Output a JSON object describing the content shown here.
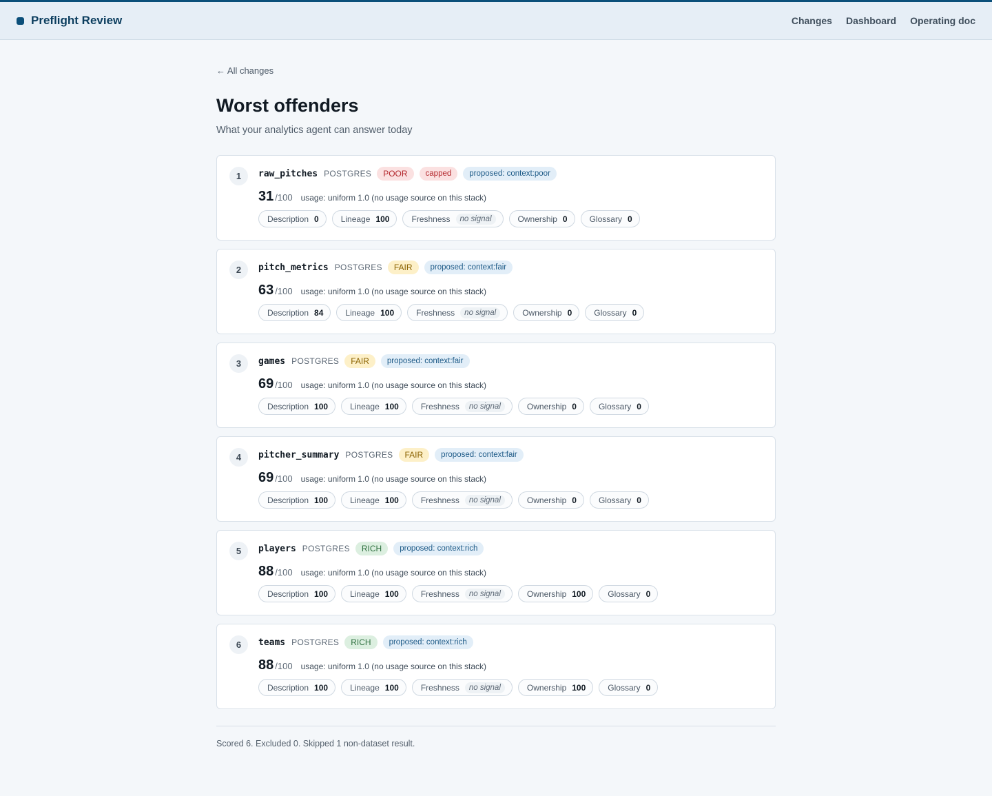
{
  "app": {
    "brand": "Preflight Review"
  },
  "nav": [
    "Changes",
    "Dashboard",
    "Operating doc"
  ],
  "back_link": "← All changes",
  "title": "Worst offenders",
  "subtitle": "What your analytics agent can answer today",
  "out_of": "/100",
  "usage_text": "usage: uniform 1.0 (no usage source on this stack)",
  "metric_labels": [
    "Description",
    "Lineage",
    "Freshness",
    "Ownership",
    "Glossary"
  ],
  "no_signal": "no signal",
  "items": [
    {
      "rank": "1",
      "name": "raw_pitches",
      "platform": "POSTGRES",
      "tier": "POOR",
      "tier_class": "poor",
      "capped": "capped",
      "proposed": "proposed: context:poor",
      "score": "31",
      "metrics": {
        "description": "0",
        "lineage": "100",
        "freshness": null,
        "ownership": "0",
        "glossary": "0"
      }
    },
    {
      "rank": "2",
      "name": "pitch_metrics",
      "platform": "POSTGRES",
      "tier": "FAIR",
      "tier_class": "fair",
      "capped": null,
      "proposed": "proposed: context:fair",
      "score": "63",
      "metrics": {
        "description": "84",
        "lineage": "100",
        "freshness": null,
        "ownership": "0",
        "glossary": "0"
      }
    },
    {
      "rank": "3",
      "name": "games",
      "platform": "POSTGRES",
      "tier": "FAIR",
      "tier_class": "fair",
      "capped": null,
      "proposed": "proposed: context:fair",
      "score": "69",
      "metrics": {
        "description": "100",
        "lineage": "100",
        "freshness": null,
        "ownership": "0",
        "glossary": "0"
      }
    },
    {
      "rank": "4",
      "name": "pitcher_summary",
      "platform": "POSTGRES",
      "tier": "FAIR",
      "tier_class": "fair",
      "capped": null,
      "proposed": "proposed: context:fair",
      "score": "69",
      "metrics": {
        "description": "100",
        "lineage": "100",
        "freshness": null,
        "ownership": "0",
        "glossary": "0"
      }
    },
    {
      "rank": "5",
      "name": "players",
      "platform": "POSTGRES",
      "tier": "RICH",
      "tier_class": "rich",
      "capped": null,
      "proposed": "proposed: context:rich",
      "score": "88",
      "metrics": {
        "description": "100",
        "lineage": "100",
        "freshness": null,
        "ownership": "100",
        "glossary": "0"
      }
    },
    {
      "rank": "6",
      "name": "teams",
      "platform": "POSTGRES",
      "tier": "RICH",
      "tier_class": "rich",
      "capped": null,
      "proposed": "proposed: context:rich",
      "score": "88",
      "metrics": {
        "description": "100",
        "lineage": "100",
        "freshness": null,
        "ownership": "100",
        "glossary": "0"
      }
    }
  ],
  "footer": "Scored 6. Excluded 0. Skipped 1 non-dataset result.",
  "colors": {
    "brand": "#0b4f7a",
    "poor": "#b3262b",
    "fair": "#8a6200",
    "rich": "#2f7040"
  }
}
